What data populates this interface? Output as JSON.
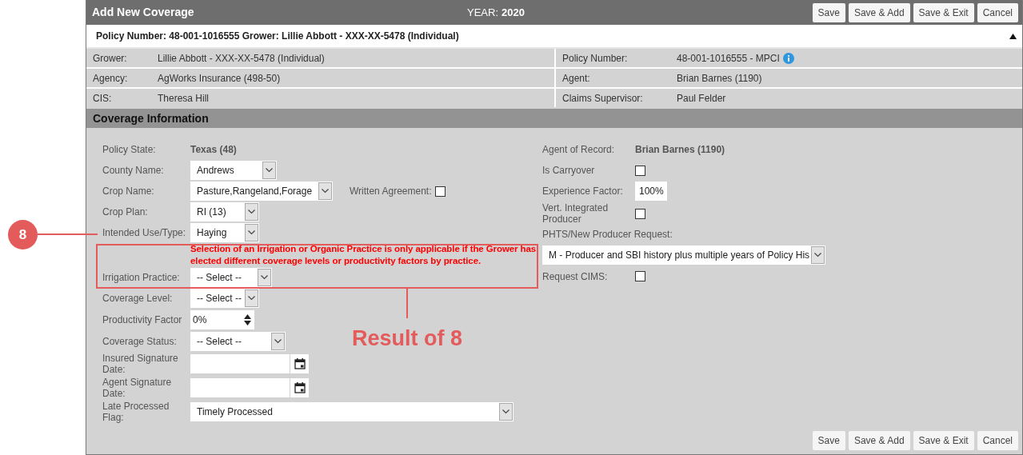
{
  "header": {
    "title": "Add New Coverage",
    "year_label": "YEAR:",
    "year": "2020",
    "buttons": [
      "Save",
      "Save & Add",
      "Save & Exit",
      "Cancel"
    ]
  },
  "policy_bar": {
    "text": "Policy Number: 48-001-1016555 Grower: Lillie Abbott - XXX-XX-5478 (Individual)",
    "expanded": true
  },
  "info_left": [
    {
      "label": "Grower:",
      "value": "Lillie Abbott - XXX-XX-5478 (Individual)"
    },
    {
      "label": "Agency:",
      "value": "AgWorks Insurance (498-50)"
    },
    {
      "label": "CIS:",
      "value": "Theresa Hill"
    }
  ],
  "info_right": [
    {
      "label": "Policy Number:",
      "value": "48-001-1016555 - MPCI",
      "info_icon": true
    },
    {
      "label": "Agent:",
      "value": "Brian Barnes (1190)",
      "info_icon": false
    },
    {
      "label": "Claims Supervisor:",
      "value": "Paul Felder",
      "info_icon": false
    }
  ],
  "section_title": "Coverage Information",
  "left_fields": [
    {
      "kind": "text",
      "label": "Policy State:",
      "value": "Texas (48)"
    },
    {
      "kind": "select",
      "label": "County Name:",
      "value": "Andrews"
    },
    {
      "kind": "select",
      "label": "Crop Name:",
      "value": "Pasture,Rangeland,Forage",
      "extra_label": "Written Agreement:",
      "extra_checked": false
    },
    {
      "kind": "select",
      "label": "Crop Plan:",
      "value": "RI (13)"
    },
    {
      "kind": "select",
      "label": "Intended Use/Type:",
      "value": "Haying"
    },
    {
      "kind": "note",
      "text": "Selection of an Irrigation or Organic Practice is only applicable if the Grower has elected different coverage levels or productivity factors by practice."
    },
    {
      "kind": "select",
      "label": "Irrigation Practice:",
      "value": "-- Select --"
    },
    {
      "kind": "select",
      "label": "Coverage Level:",
      "value": "-- Select --"
    },
    {
      "kind": "spinner",
      "label": "Productivity Factor",
      "value": "0%"
    },
    {
      "kind": "select",
      "label": "Coverage Status:",
      "value": "-- Select --"
    },
    {
      "kind": "date",
      "label": "Insured Signature Date:"
    },
    {
      "kind": "date",
      "label": "Agent Signature Date:"
    },
    {
      "kind": "select",
      "label": "Late Processed Flag:",
      "value": "Timely Processed"
    }
  ],
  "right_fields": [
    {
      "kind": "text",
      "label": "Agent of Record:",
      "value": "Brian Barnes (1190)"
    },
    {
      "kind": "checkbox",
      "label": "Is Carryover",
      "checked": false
    },
    {
      "kind": "input",
      "label": "Experience Factor:",
      "value": "100%"
    },
    {
      "kind": "checkbox",
      "label": "Vert. Integrated Producer",
      "checked": false
    },
    {
      "kind": "heading",
      "label": "PHTS/New Producer Request:"
    },
    {
      "kind": "wide_select",
      "value": "M - Producer and SBI history plus multiple years of Policy His"
    },
    {
      "kind": "checkbox",
      "label": "Request CIMS:",
      "checked": false
    }
  ],
  "footer_buttons": [
    "Save",
    "Save & Add",
    "Save & Exit",
    "Cancel"
  ],
  "annotations": {
    "callout": "8",
    "result_label": "Result of 8"
  }
}
